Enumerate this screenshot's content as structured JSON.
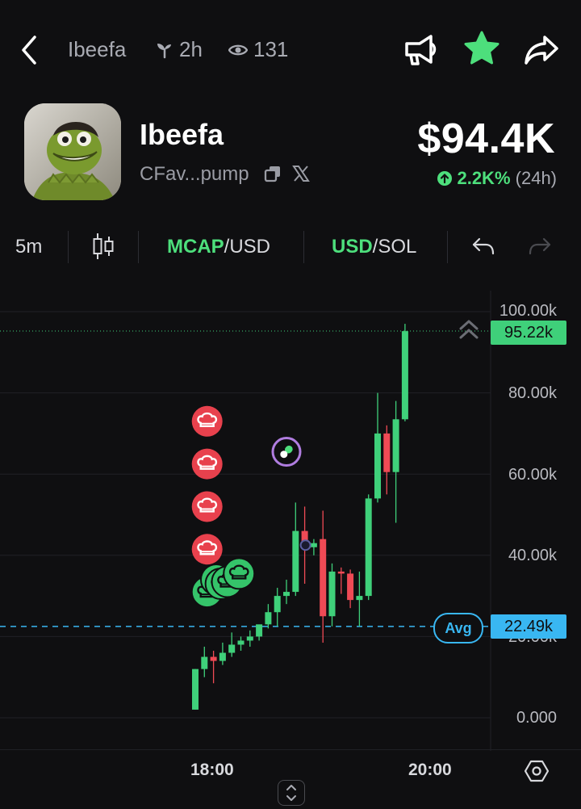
{
  "header": {
    "back_icon": "chevron-left-icon",
    "token_name": "Ibeefa",
    "age": "2h",
    "views": "131",
    "actions": [
      "megaphone-icon",
      "star-icon",
      "share-icon"
    ],
    "accent_green": "#4ddf7c"
  },
  "token": {
    "name": "Ibeefa",
    "address_short": "CFav...pump",
    "price": "$94.4K",
    "change": "2.2K%",
    "change_period": "(24h)"
  },
  "toolbar": {
    "interval": "5m",
    "mcap_label": "MCAP",
    "mcap_suffix": "/USD",
    "usd_label": "USD",
    "usd_suffix": "/SOL"
  },
  "chart_data": {
    "type": "candlestick",
    "y_axis_labels": [
      "100.00k",
      "80.00k",
      "60.00k",
      "40.00k",
      "20.00k",
      "0.000"
    ],
    "ylim": [
      0,
      100000
    ],
    "x_axis_labels": [
      "18:00",
      "20:00"
    ],
    "current_value_label": "95.22k",
    "current_value": 95220,
    "avg_label": "Avg",
    "avg_value_label": "22.49k",
    "avg_value": 22490,
    "colors": {
      "up": "#3fd07a",
      "down": "#ef4a55",
      "avg": "#39b7f2"
    },
    "candles": [
      {
        "o": 2000,
        "h": 12000,
        "l": 2000,
        "c": 12000
      },
      {
        "o": 12000,
        "h": 17500,
        "l": 10000,
        "c": 15000
      },
      {
        "o": 15000,
        "h": 16500,
        "l": 8500,
        "c": 14000
      },
      {
        "o": 14000,
        "h": 18500,
        "l": 13000,
        "c": 16000
      },
      {
        "o": 16000,
        "h": 21000,
        "l": 15000,
        "c": 18000
      },
      {
        "o": 18000,
        "h": 20000,
        "l": 16500,
        "c": 19000
      },
      {
        "o": 19000,
        "h": 21500,
        "l": 17500,
        "c": 20000
      },
      {
        "o": 20000,
        "h": 22500,
        "l": 19000,
        "c": 23000
      },
      {
        "o": 23000,
        "h": 28000,
        "l": 22000,
        "c": 26000
      },
      {
        "o": 26000,
        "h": 32000,
        "l": 22500,
        "c": 30000
      },
      {
        "o": 30000,
        "h": 34000,
        "l": 28000,
        "c": 31000
      },
      {
        "o": 31000,
        "h": 53000,
        "l": 30000,
        "c": 46000
      },
      {
        "o": 46000,
        "h": 52000,
        "l": 33000,
        "c": 42000
      },
      {
        "o": 42000,
        "h": 44000,
        "l": 40000,
        "c": 43000
      },
      {
        "o": 44000,
        "h": 51000,
        "l": 18500,
        "c": 25000
      },
      {
        "o": 25000,
        "h": 38000,
        "l": 22500,
        "c": 36000
      },
      {
        "o": 36000,
        "h": 37000,
        "l": 30500,
        "c": 35500
      },
      {
        "o": 35500,
        "h": 36500,
        "l": 27000,
        "c": 29000
      },
      {
        "o": 29000,
        "h": 36000,
        "l": 22500,
        "c": 30000
      },
      {
        "o": 30000,
        "h": 55000,
        "l": 29000,
        "c": 54000
      },
      {
        "o": 54000,
        "h": 80000,
        "l": 53000,
        "c": 70000
      },
      {
        "o": 70000,
        "h": 72000,
        "l": 55000,
        "c": 60500
      },
      {
        "o": 60500,
        "h": 78000,
        "l": 48000,
        "c": 73500
      },
      {
        "o": 73500,
        "h": 97000,
        "l": 73000,
        "c": 95200
      }
    ],
    "markers": [
      {
        "kind": "sell",
        "label": "chef-hat-icon",
        "value": 73000,
        "candle": 1.3
      },
      {
        "kind": "sell",
        "label": "chef-hat-icon",
        "value": 62500,
        "candle": 1.3
      },
      {
        "kind": "sell",
        "label": "chef-hat-icon",
        "value": 52000,
        "candle": 1.3
      },
      {
        "kind": "sell",
        "label": "chef-hat-icon",
        "value": 41500,
        "candle": 1.3
      },
      {
        "kind": "buy",
        "label": "chef-hat-icon",
        "value": 31000,
        "candle": 1.3
      },
      {
        "kind": "buy",
        "label": "chef-hat-icon",
        "value": 34000,
        "candle": 2.3
      },
      {
        "kind": "buy",
        "label": "chef-hat-icon",
        "value": 33000,
        "candle": 2.8
      },
      {
        "kind": "buy",
        "label": "chef-hat-icon",
        "value": 33500,
        "candle": 3.5
      },
      {
        "kind": "buy",
        "label": "chef-hat-icon",
        "value": 35500,
        "candle": 4.8
      },
      {
        "kind": "pill",
        "label": "pill-icon",
        "value": 65500,
        "candle": 10.0
      }
    ]
  },
  "footer": {
    "settings_icon": "hexagon-settings-icon",
    "expand_icon": "expand-vertical-icon"
  }
}
